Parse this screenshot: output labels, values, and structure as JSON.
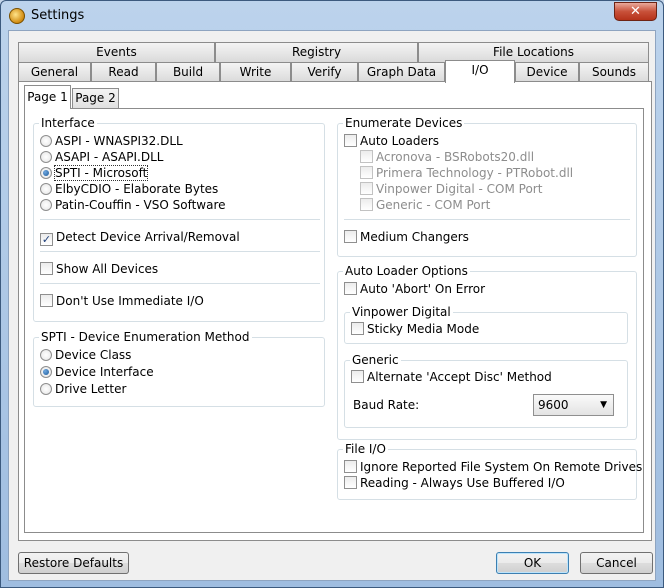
{
  "window": {
    "title": "Settings",
    "close_label": "✕"
  },
  "tabs_top": [
    "Events",
    "Registry",
    "File Locations"
  ],
  "tabs_bottom": [
    "General",
    "Read",
    "Build",
    "Write",
    "Verify",
    "Graph Data",
    "I/O",
    "Device",
    "Sounds"
  ],
  "active_tab": "I/O",
  "subtabs": [
    "Page 1",
    "Page 2"
  ],
  "active_subtab": "Page 1",
  "interface": {
    "title": "Interface",
    "options": [
      "ASPI - WNASPI32.DLL",
      "ASAPI - ASAPI.DLL",
      "SPTI - Microsoft",
      "ElbyCDIO - Elaborate Bytes",
      "Patin-Couffin - VSO Software"
    ],
    "selected": "SPTI - Microsoft",
    "detect_arrival": {
      "label": "Detect Device Arrival/Removal",
      "checked": true
    },
    "show_all": {
      "label": "Show All Devices",
      "checked": false
    },
    "no_immediate": {
      "label": "Don't Use Immediate I/O",
      "checked": false
    }
  },
  "spti_enum": {
    "title": "SPTI - Device Enumeration Method",
    "options": [
      "Device Class",
      "Device Interface",
      "Drive Letter"
    ],
    "selected": "Device Interface"
  },
  "enumerate": {
    "title": "Enumerate Devices",
    "auto_loaders": {
      "label": "Auto Loaders",
      "checked": false
    },
    "loaders": [
      "Acronova - BSRobots20.dll",
      "Primera Technology - PTRobot.dll",
      "Vinpower Digital - COM Port",
      "Generic - COM Port"
    ],
    "medium_changers": {
      "label": "Medium Changers",
      "checked": false
    }
  },
  "auto_loader_options": {
    "title": "Auto Loader Options",
    "abort_on_error": {
      "label": "Auto 'Abort' On Error",
      "checked": false
    },
    "vinpower": {
      "title": "Vinpower Digital",
      "sticky": {
        "label": "Sticky Media Mode",
        "checked": false
      }
    },
    "generic": {
      "title": "Generic",
      "alternate_accept": {
        "label": "Alternate 'Accept Disc' Method",
        "checked": false
      },
      "baud_label": "Baud Rate:",
      "baud_value": "9600"
    }
  },
  "file_io": {
    "title": "File I/O",
    "ignore_fs": {
      "label": "Ignore Reported File System On Remote Drives",
      "checked": false
    },
    "buffered": {
      "label": "Reading - Always Use Buffered I/O",
      "checked": false
    }
  },
  "buttons": {
    "restore": "Restore Defaults",
    "ok": "OK",
    "cancel": "Cancel"
  }
}
